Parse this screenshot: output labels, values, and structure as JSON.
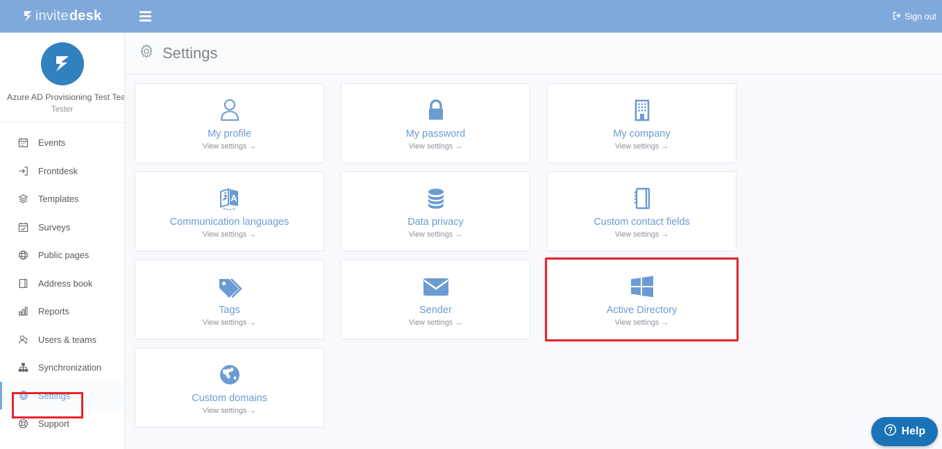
{
  "topbar": {
    "brand_light": "invite",
    "brand_bold": "desk",
    "brand_icon": "invitedesk-logo-mark",
    "menu_icon": "hamburger-menu-icon",
    "signout_label": "Sign out",
    "signout_icon": "sign-out-icon",
    "background_color": "#7fa9da"
  },
  "sidebar": {
    "avatar_icon": "invitedesk-avatar-logo",
    "profile_name": "Azure AD Provisioning Test Team",
    "profile_role": "Tester",
    "items": [
      {
        "label": "Events",
        "icon": "calendar-icon",
        "active": false
      },
      {
        "label": "Frontdesk",
        "icon": "login-arrow-icon",
        "active": false
      },
      {
        "label": "Templates",
        "icon": "layers-icon",
        "active": false
      },
      {
        "label": "Surveys",
        "icon": "calendar-check-icon",
        "active": false
      },
      {
        "label": "Public pages",
        "icon": "globe-grid-icon",
        "active": false
      },
      {
        "label": "Address book",
        "icon": "book-icon",
        "active": false
      },
      {
        "label": "Reports",
        "icon": "bar-chart-icon",
        "active": false
      },
      {
        "label": "Users & teams",
        "icon": "users-icon",
        "active": false
      },
      {
        "label": "Synchronization",
        "icon": "sitemap-icon",
        "active": false
      },
      {
        "label": "Settings",
        "icon": "gear-icon",
        "active": true
      },
      {
        "label": "Support",
        "icon": "lifebuoy-icon",
        "active": false
      }
    ],
    "active_accent_color": "#7fa9da"
  },
  "header": {
    "icon": "gear-icon",
    "title": "Settings"
  },
  "cards": [
    {
      "title": "My profile",
      "sub": "View settings →",
      "icon": "user-icon",
      "highlighted": false
    },
    {
      "title": "My password",
      "sub": "View settings →",
      "icon": "lock-icon",
      "highlighted": false
    },
    {
      "title": "My company",
      "sub": "View settings →",
      "icon": "building-icon",
      "highlighted": false
    },
    {
      "title": "Communication languages",
      "sub": "View settings →",
      "icon": "translate-icon",
      "highlighted": false
    },
    {
      "title": "Data privacy",
      "sub": "View settings →",
      "icon": "database-icon",
      "highlighted": false
    },
    {
      "title": "Custom contact fields",
      "sub": "View settings →",
      "icon": "notebook-icon",
      "highlighted": false
    },
    {
      "title": "Tags",
      "sub": "View settings →",
      "icon": "tags-icon",
      "highlighted": false
    },
    {
      "title": "Sender",
      "sub": "View settings →",
      "icon": "envelope-icon",
      "highlighted": false
    },
    {
      "title": "Active Directory",
      "sub": "View settings →",
      "icon": "windows-logo-icon",
      "highlighted": true
    },
    {
      "title": "Custom domains",
      "sub": "View settings →",
      "icon": "globe-icon",
      "highlighted": false
    }
  ],
  "help": {
    "label": "Help",
    "icon": "question-circle-icon",
    "color": "#1a73b7"
  },
  "annotations": {
    "highlight_color": "#e8232a",
    "targets": [
      "sidebar-item-settings",
      "card-active-directory"
    ]
  },
  "theme": {
    "accent": "#6b9bd2",
    "topbar": "#7fa9da",
    "page_bg": "#f7f9fc",
    "card_bg": "#ffffff"
  }
}
